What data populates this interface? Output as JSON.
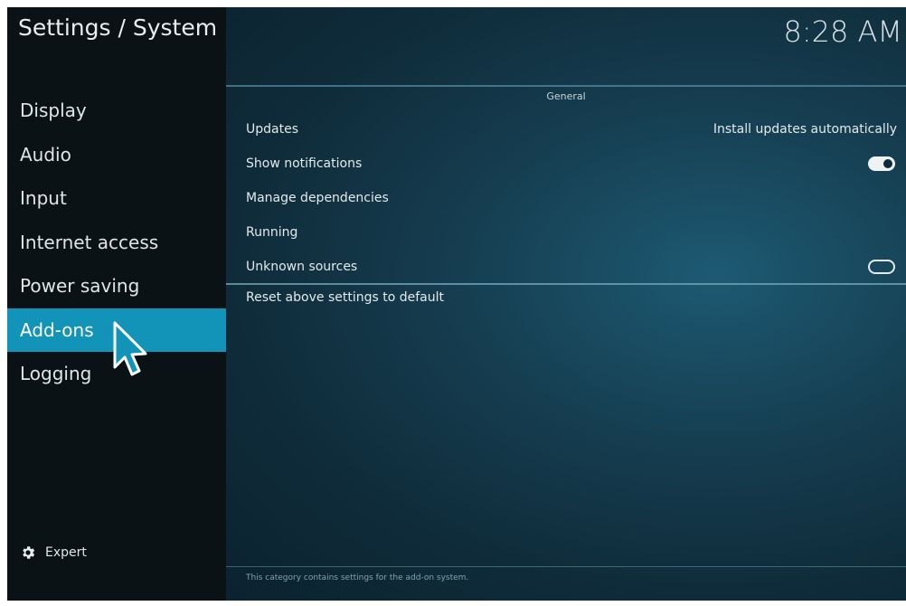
{
  "header": {
    "title": "Settings / System",
    "clock": "8:28 AM"
  },
  "sidebar": {
    "items": [
      {
        "label": "Display",
        "active": false
      },
      {
        "label": "Audio",
        "active": false
      },
      {
        "label": "Input",
        "active": false
      },
      {
        "label": "Internet access",
        "active": false
      },
      {
        "label": "Power saving",
        "active": false
      },
      {
        "label": "Add-ons",
        "active": true
      },
      {
        "label": "Logging",
        "active": false
      }
    ],
    "expert_label": "Expert"
  },
  "main": {
    "section_header": "General",
    "settings": [
      {
        "label": "Updates",
        "value": "Install updates automatically"
      },
      {
        "label": "Show notifications",
        "toggle": "on"
      },
      {
        "label": "Manage dependencies"
      },
      {
        "label": "Running"
      },
      {
        "label": "Unknown sources",
        "toggle": "off"
      }
    ],
    "reset_label": "Reset above settings to default",
    "footer_description": "This category contains settings for the add-on system."
  },
  "colors": {
    "accent": "#1294b8",
    "sidebar_bg": "#0b1216",
    "main_bg": "#163f52"
  },
  "icons": {
    "expert": "gear-icon",
    "cursor": "mouse-pointer-icon"
  }
}
